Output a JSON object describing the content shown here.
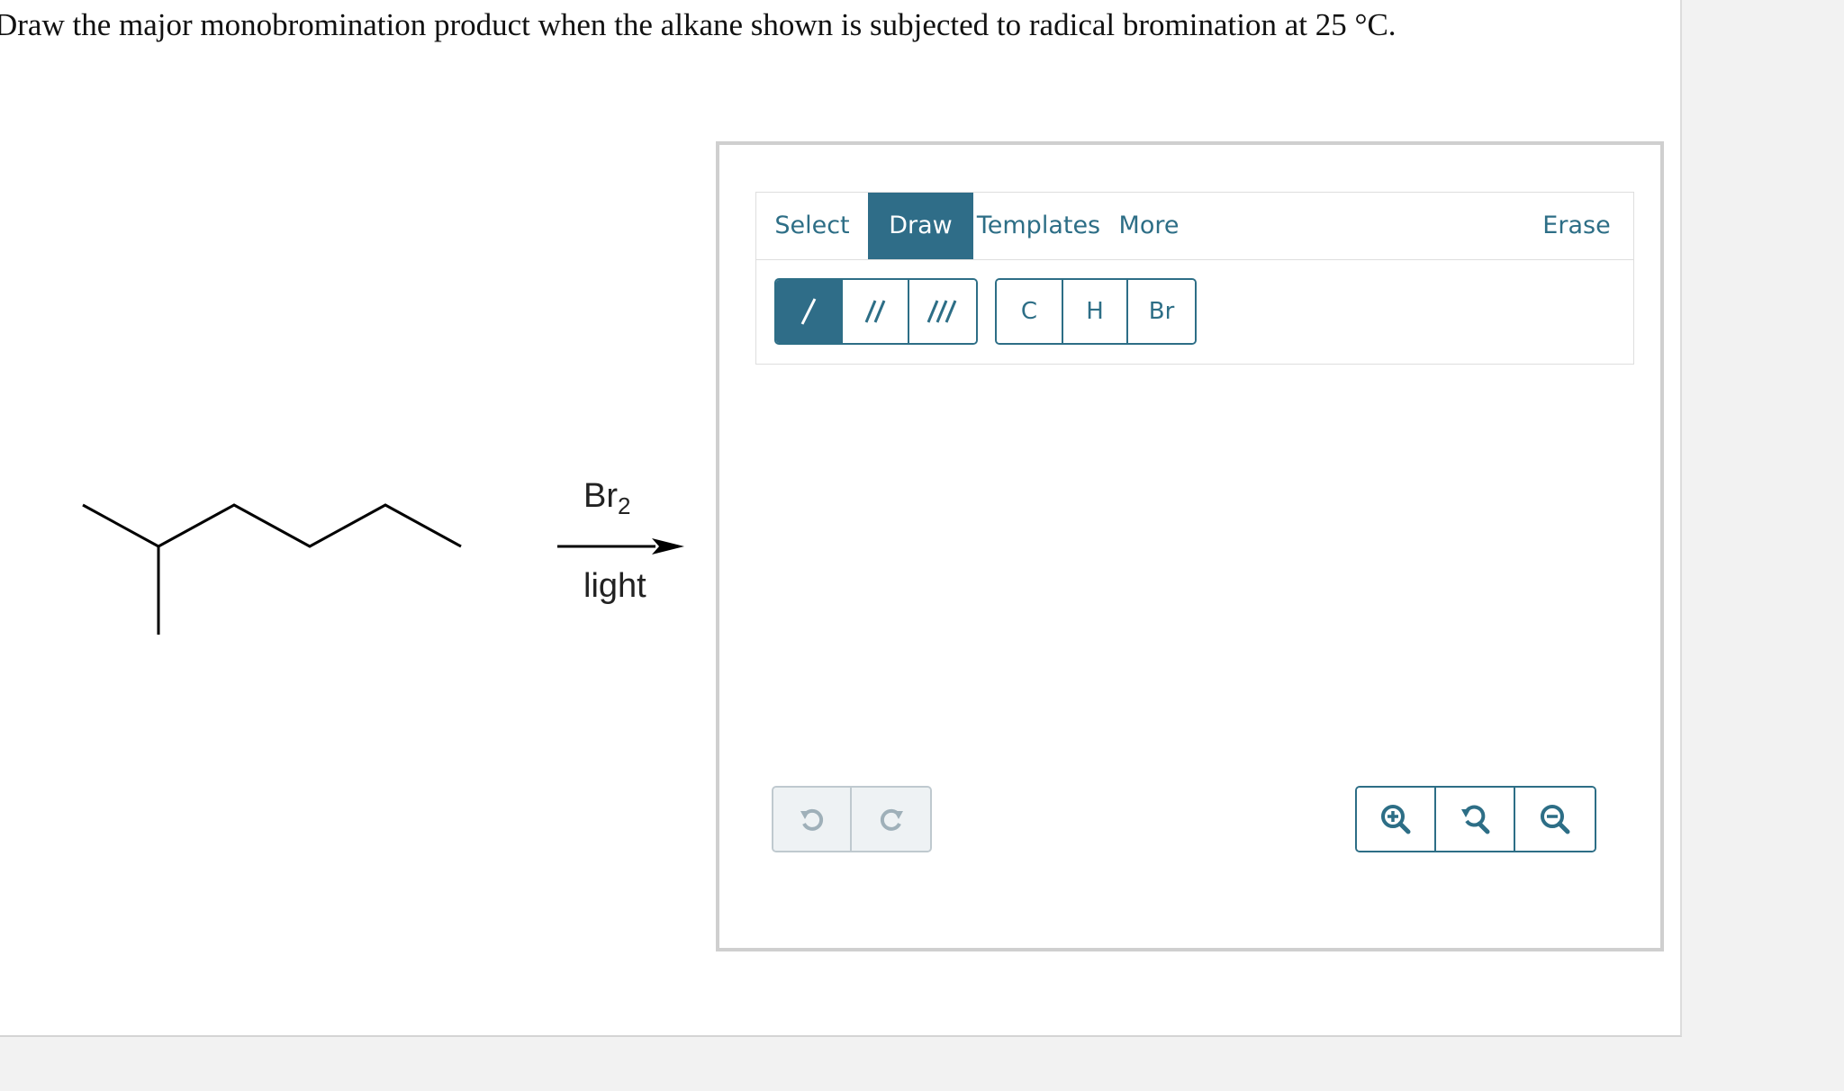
{
  "question": "Draw the major monobromination product when the alkane shown is subjected to radical bromination at 25 °C.",
  "reaction": {
    "reagent_above": "Br",
    "reagent_subscript": "2",
    "reagent_below": "light"
  },
  "editor": {
    "tabs": [
      {
        "label": "Select",
        "active": false
      },
      {
        "label": "Draw",
        "active": true
      },
      {
        "label": "Templates",
        "active": false
      },
      {
        "label": "More",
        "active": false
      }
    ],
    "erase_label": "Erase",
    "bond_tools": [
      {
        "icon": "single-bond-icon",
        "active": true
      },
      {
        "icon": "double-bond-icon",
        "active": false
      },
      {
        "icon": "triple-bond-icon",
        "active": false
      }
    ],
    "atom_tools": [
      "C",
      "H",
      "Br"
    ],
    "history_tools": [
      "undo-icon",
      "redo-icon"
    ],
    "zoom_tools": [
      "zoom-in-icon",
      "zoom-reset-icon",
      "zoom-out-icon"
    ]
  },
  "colors": {
    "accent": "#2f6d88",
    "tool_text": "#2d6e86",
    "disabled_border": "#bfc9cf"
  }
}
